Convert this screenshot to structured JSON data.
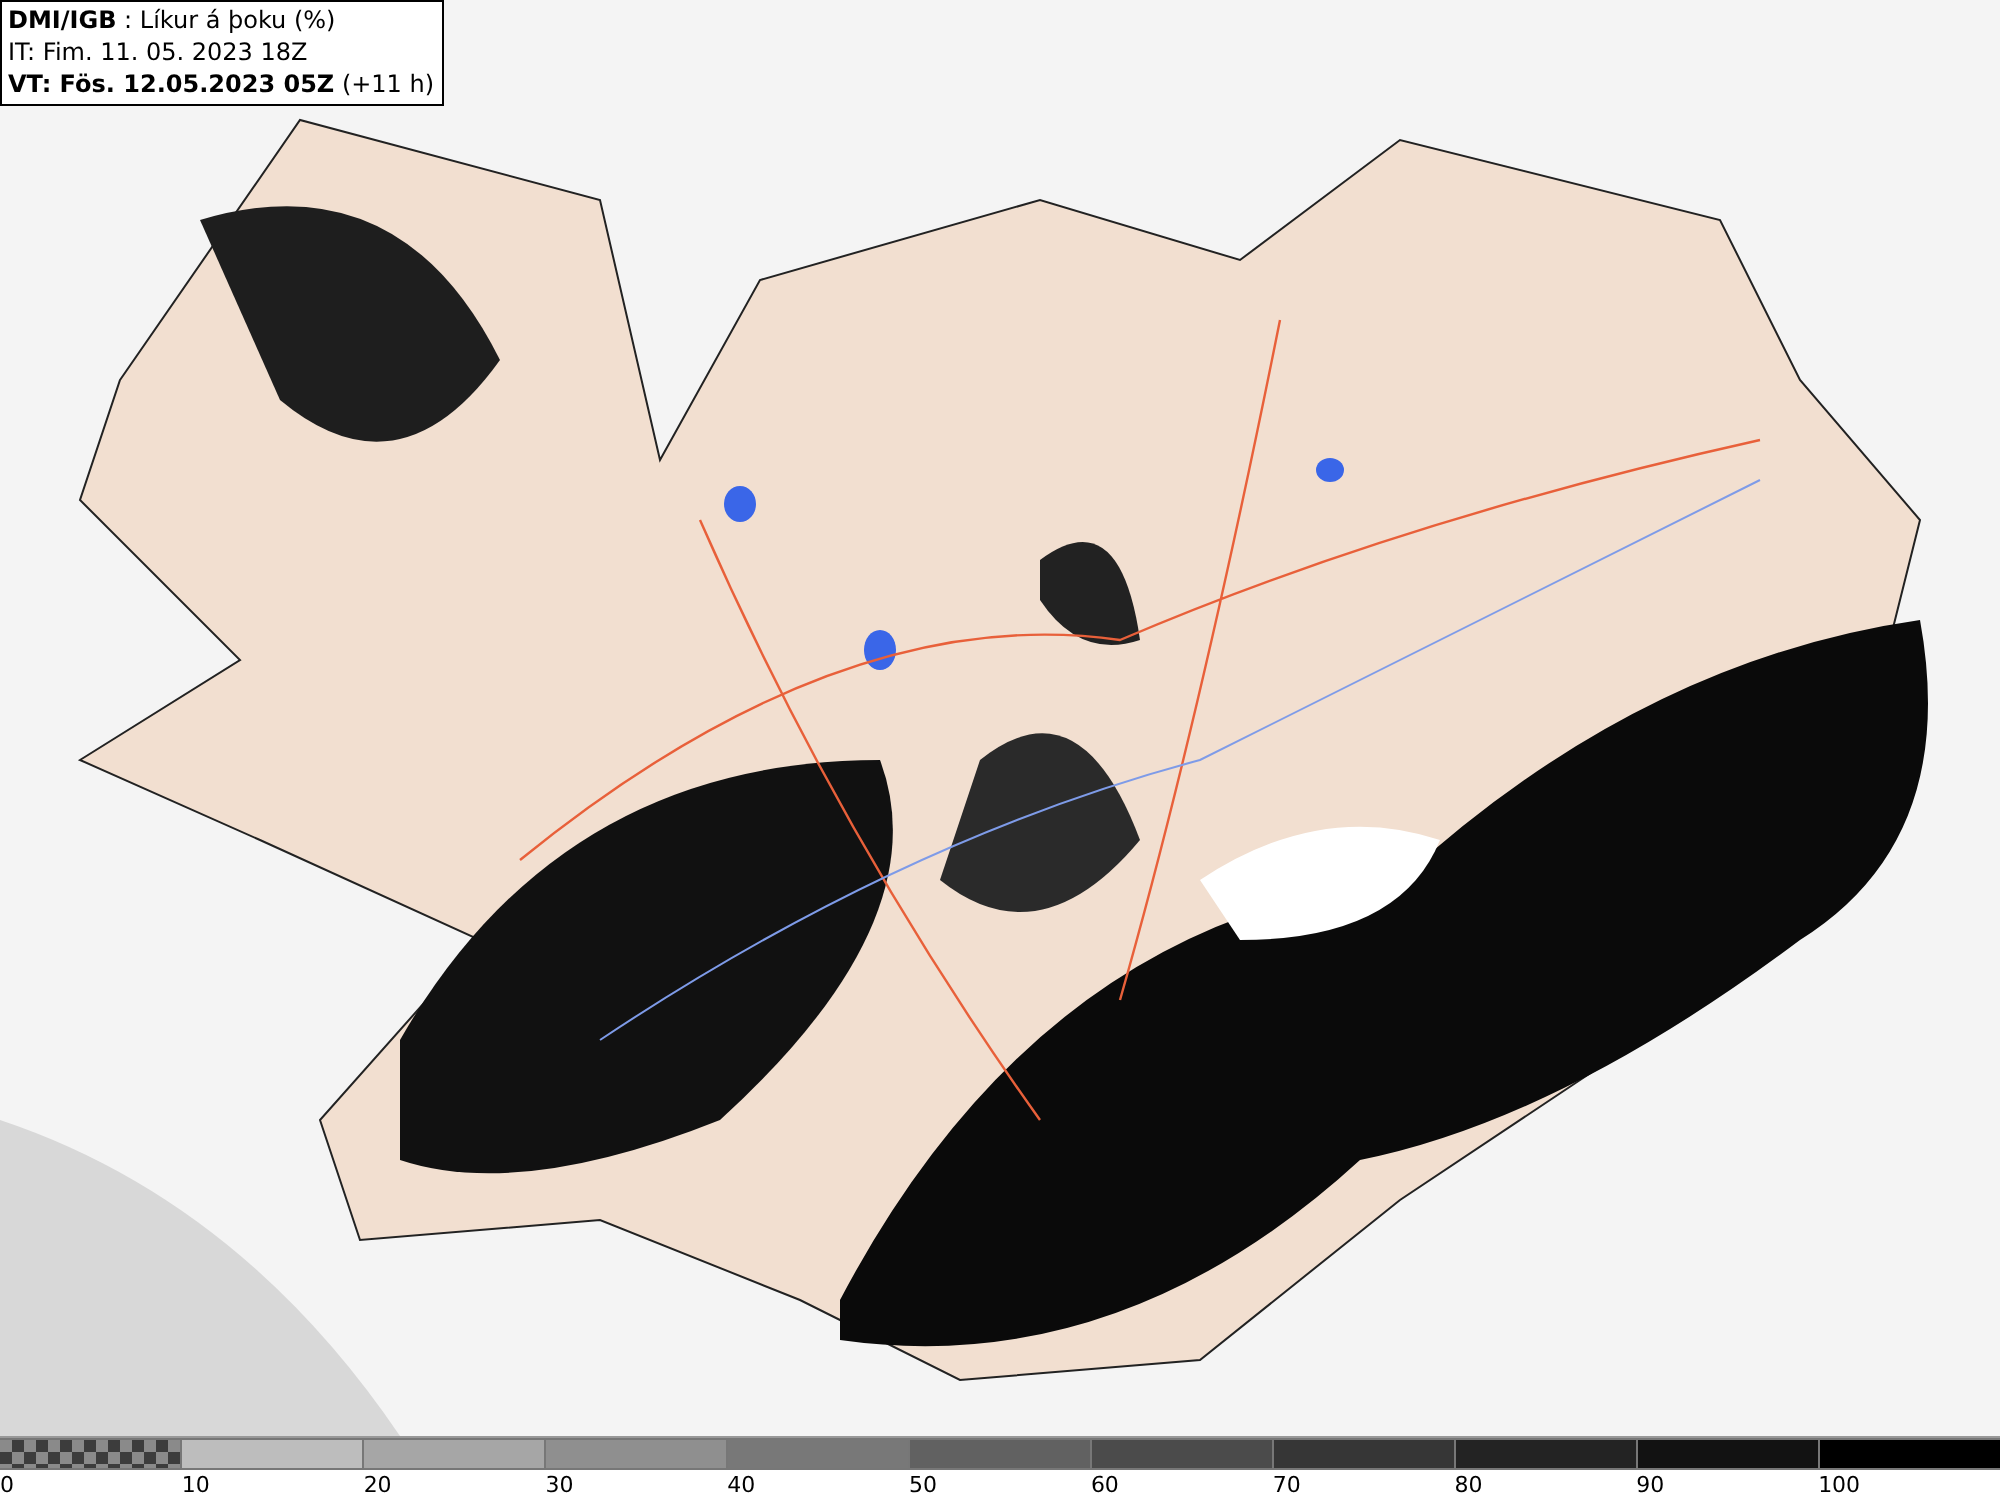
{
  "header": {
    "lines": [
      "**DMI/IGB** : Líkur á þoku (%)",
      "IT: Fim. 11. 05. 2023 18Z",
      "**VT: Fös. 12.05.2023 05Z** (+11 h)"
    ]
  },
  "legend": {
    "segments": [
      {
        "kind": "checker",
        "color": "#8a8a8a"
      },
      {
        "kind": "solid",
        "color": "#bdbdbd"
      },
      {
        "kind": "solid",
        "color": "#a6a6a6"
      },
      {
        "kind": "solid",
        "color": "#8f8f8f"
      },
      {
        "kind": "solid",
        "color": "#787878"
      },
      {
        "kind": "solid",
        "color": "#616161"
      },
      {
        "kind": "solid",
        "color": "#4b4b4b"
      },
      {
        "kind": "solid",
        "color": "#363636"
      },
      {
        "kind": "solid",
        "color": "#232323"
      },
      {
        "kind": "solid",
        "color": "#121212"
      },
      {
        "kind": "solid",
        "color": "#000000"
      }
    ],
    "labels": [
      "0",
      "10",
      "20",
      "30",
      "40",
      "50",
      "60",
      "70",
      "80",
      "90",
      "100"
    ]
  }
}
